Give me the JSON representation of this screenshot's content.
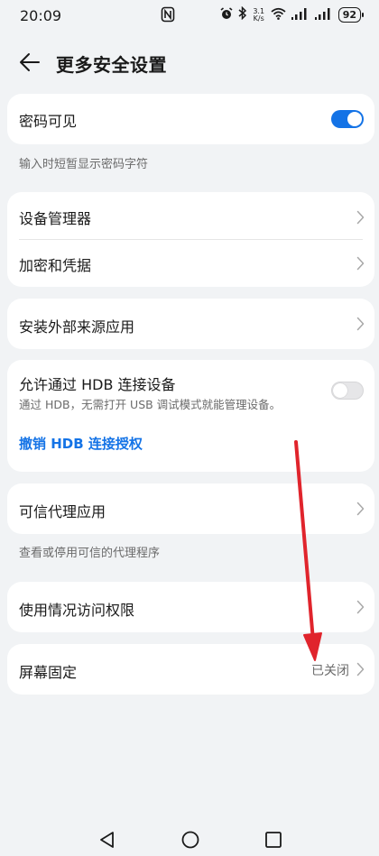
{
  "status_bar": {
    "time": "20:09",
    "net_speed_value": "3.1",
    "net_speed_unit": "K/s",
    "battery": "92"
  },
  "header": {
    "title": "更多安全设置"
  },
  "sections": {
    "password_visible": {
      "label": "密码可见",
      "toggle_on": true,
      "helper": "输入时短暂显示密码字符"
    },
    "device_manager": {
      "label": "设备管理器"
    },
    "encryption": {
      "label": "加密和凭据"
    },
    "install_external": {
      "label": "安装外部来源应用"
    },
    "hdb": {
      "label": "允许通过 HDB 连接设备",
      "sub": "通过 HDB，无需打开 USB 调试模式就能管理设备。",
      "toggle_on": false,
      "revoke_link": "撤销 HDB 连接授权"
    },
    "trust_agent": {
      "label": "可信代理应用",
      "helper": "查看或停用可信的代理程序"
    },
    "usage_access": {
      "label": "使用情况访问权限"
    },
    "screen_pin": {
      "label": "屏幕固定",
      "value": "已关闭"
    }
  },
  "colors": {
    "accent": "#1473e6",
    "background": "#f1f3f5",
    "annotation_arrow": "#e0242c"
  },
  "icons": {
    "back": "back-arrow-icon",
    "chevron": "chevron-right-icon",
    "nav_back": "triangle-back-icon",
    "nav_home": "circle-home-icon",
    "nav_recent": "square-recent-icon"
  }
}
